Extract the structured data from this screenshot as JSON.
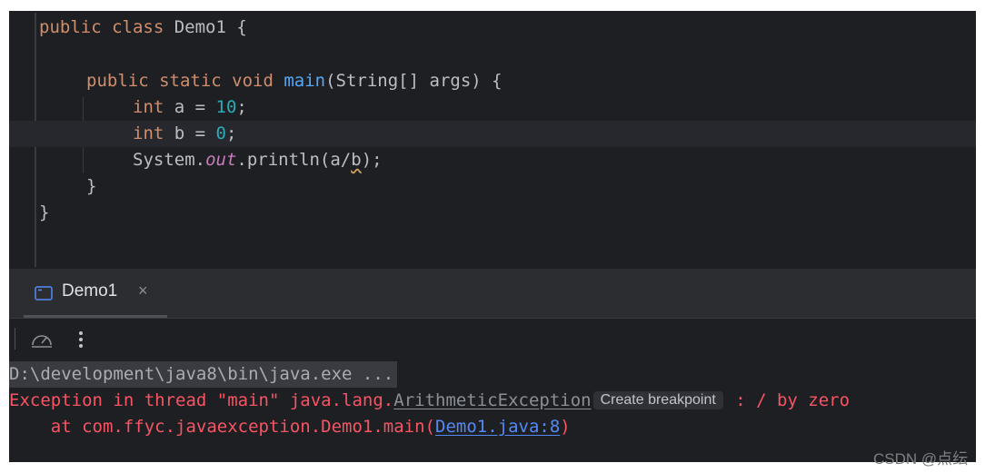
{
  "editor": {
    "line1": {
      "kw": "public class ",
      "name": "Demo1 {"
    },
    "line2": {
      "kw": "public static void ",
      "fn": "main",
      "rest": "(String[] args) {"
    },
    "line3": {
      "kw": "int",
      "mid": " a = ",
      "num": "10",
      "end": ";"
    },
    "line4": {
      "kw": "int",
      "mid": " b = ",
      "num": "0",
      "end": ";"
    },
    "line5": {
      "pre": "System.",
      "field": "out",
      "mid": ".println(a/",
      "var": "b",
      "end": ");"
    },
    "line6": "}",
    "line7": "}"
  },
  "run_panel": {
    "tab_label": "Demo1",
    "tab_close": "×"
  },
  "icons": {
    "tab": "console-window-icon",
    "toolbar_1": "gauge-icon",
    "toolbar_2": "more-vertical-icon"
  },
  "console": {
    "command": "D:\\development\\java8\\bin\\java.exe ...",
    "exception": {
      "prefix": "Exception in thread \"main\" java.lang.",
      "class_link": "ArithmeticException",
      "breakpoint_button": "Create breakpoint",
      "message": " : / by zero"
    },
    "trace": {
      "prefix": "    at com.ffyc.javaexception.Demo1.main(",
      "link": "Demo1.java:8",
      "suffix": ")"
    }
  },
  "watermark": "CSDN @点纭",
  "colors": {
    "background": "#1e1f22",
    "keyword": "#cf8e6d",
    "function": "#56a8f5",
    "number": "#2aacb8",
    "error": "#f75464",
    "link": "#548af7"
  }
}
